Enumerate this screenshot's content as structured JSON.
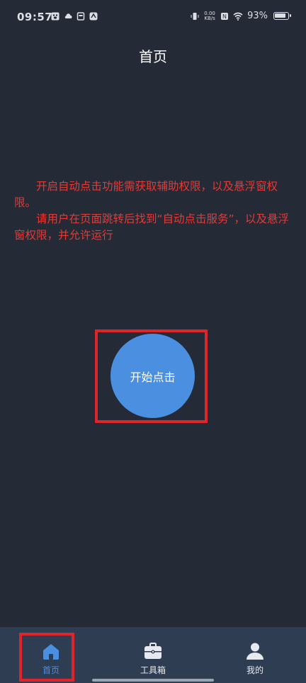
{
  "status_bar": {
    "time": "09:57",
    "left_icons": [
      "baidu-icon",
      "cloud-icon",
      "sim-icon",
      "sync-icon"
    ],
    "net_speed_value": "0.00",
    "net_speed_unit": "KB/s",
    "battery_percent": "93%",
    "right_icons": [
      "vibrate-icon",
      "nfc-icon",
      "wifi-icon",
      "battery-icon"
    ]
  },
  "header": {
    "title": "首页"
  },
  "notice": {
    "color": "#e53935",
    "line1": "开启自动点击功能需获取辅助权限，以及悬浮窗权限。",
    "line2": "请用户在页面跳转后找到“自动点击服务”，以及悬浮窗权限，并允许运行"
  },
  "main": {
    "start_button_label": "开始点击",
    "button_color": "#4a8fe0"
  },
  "bottom_nav": {
    "items": [
      {
        "label": "首页",
        "icon": "home-icon",
        "active": true
      },
      {
        "label": "工具箱",
        "icon": "toolbox-icon",
        "active": false
      },
      {
        "label": "我的",
        "icon": "user-icon",
        "active": false
      }
    ],
    "active_color": "#4a8fe0"
  }
}
